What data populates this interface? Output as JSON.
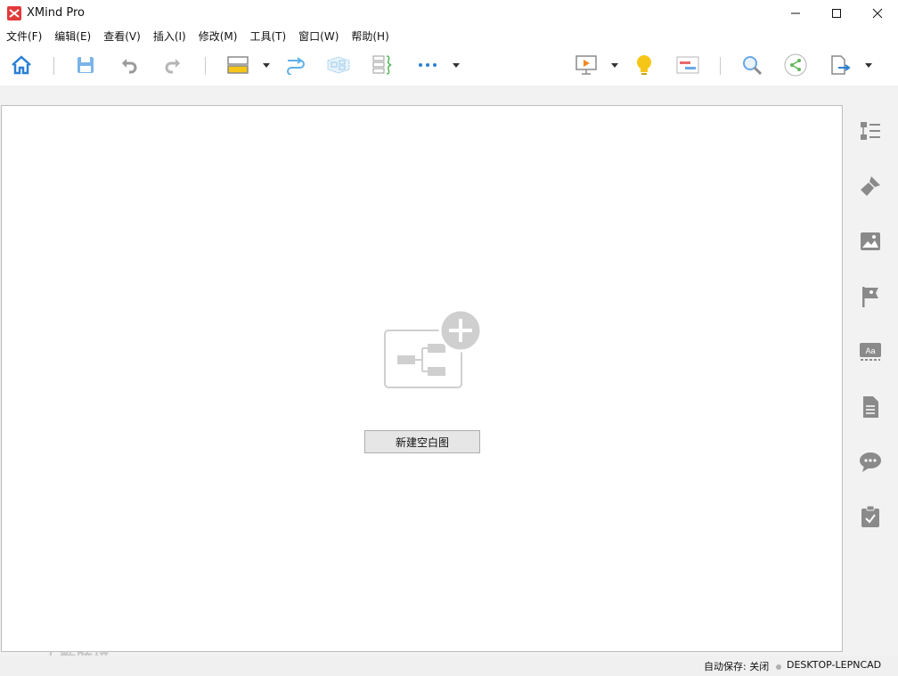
{
  "window": {
    "title": "XMind Pro"
  },
  "menu": {
    "items": [
      "文件(F)",
      "编辑(E)",
      "查看(V)",
      "插入(I)",
      "修改(M)",
      "工具(T)",
      "窗口(W)",
      "帮助(H)"
    ]
  },
  "toolbar": {
    "icons": [
      "home-icon",
      "save-icon",
      "undo-icon",
      "redo-icon",
      "topic-icon",
      "relationship-icon",
      "boundary-icon",
      "summary-icon",
      "more-icon",
      "presentation-icon",
      "brainstorm-icon",
      "gantt-icon",
      "search-icon",
      "share-icon",
      "export-icon"
    ]
  },
  "canvas": {
    "new_blank_label": "新建空白图"
  },
  "sidebar": {
    "icons": [
      "outline-icon",
      "format-icon",
      "image-icon",
      "marker-icon",
      "text-icon",
      "notes-icon",
      "comments-icon",
      "task-icon"
    ]
  },
  "status": {
    "autosave": "自动保存: 关闭",
    "device": "DESKTOP-LEPNCAD"
  },
  "watermark": {
    "text": "大数跨境"
  },
  "colors": {
    "accent_blue": "#2a7fd4",
    "brand_red": "#e23a3a",
    "bulb_yellow": "#f5c518"
  }
}
